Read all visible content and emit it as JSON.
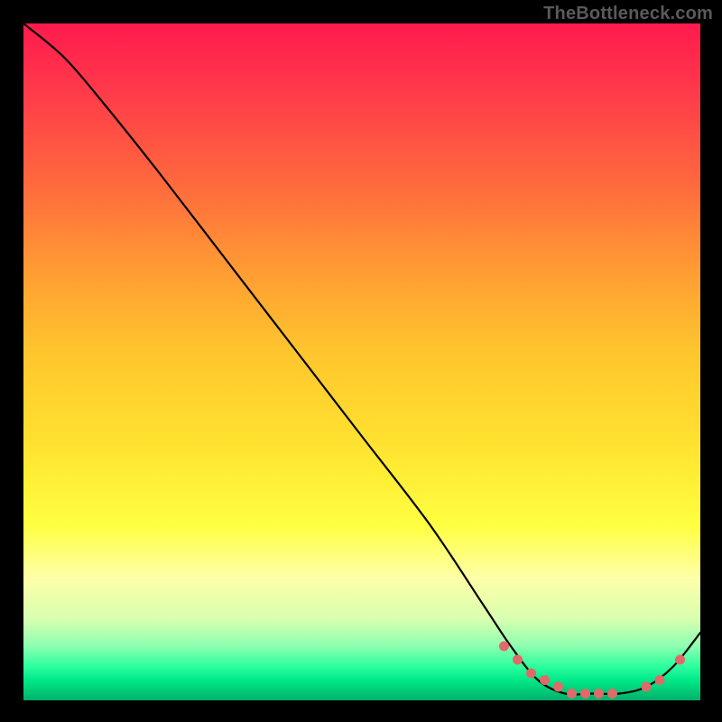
{
  "watermark": "TheBottleneck.com",
  "colors": {
    "background": "#000000",
    "curve": "#000000",
    "marker": "#e06a6a",
    "gradient_top": "#ff1a4d",
    "gradient_bottom": "#00af6a"
  },
  "chart_data": {
    "type": "line",
    "title": "",
    "xlabel": "",
    "ylabel": "",
    "xlim": [
      0,
      100
    ],
    "ylim": [
      0,
      100
    ],
    "series": [
      {
        "name": "curve",
        "x": [
          0,
          6,
          12,
          20,
          30,
          40,
          50,
          60,
          68,
          72,
          76,
          80,
          84,
          88,
          92,
          96,
          100
        ],
        "y": [
          100,
          95,
          88,
          78,
          65,
          52,
          39,
          26,
          14,
          8,
          3,
          1,
          1,
          1,
          2,
          5,
          10
        ]
      }
    ],
    "markers": {
      "name": "highlight-dots",
      "x": [
        71,
        73,
        75,
        77,
        79,
        81,
        83,
        85,
        87,
        92,
        94,
        97
      ],
      "y": [
        8,
        6,
        4,
        3,
        2,
        1,
        1,
        1,
        1,
        2,
        3,
        6
      ]
    }
  }
}
